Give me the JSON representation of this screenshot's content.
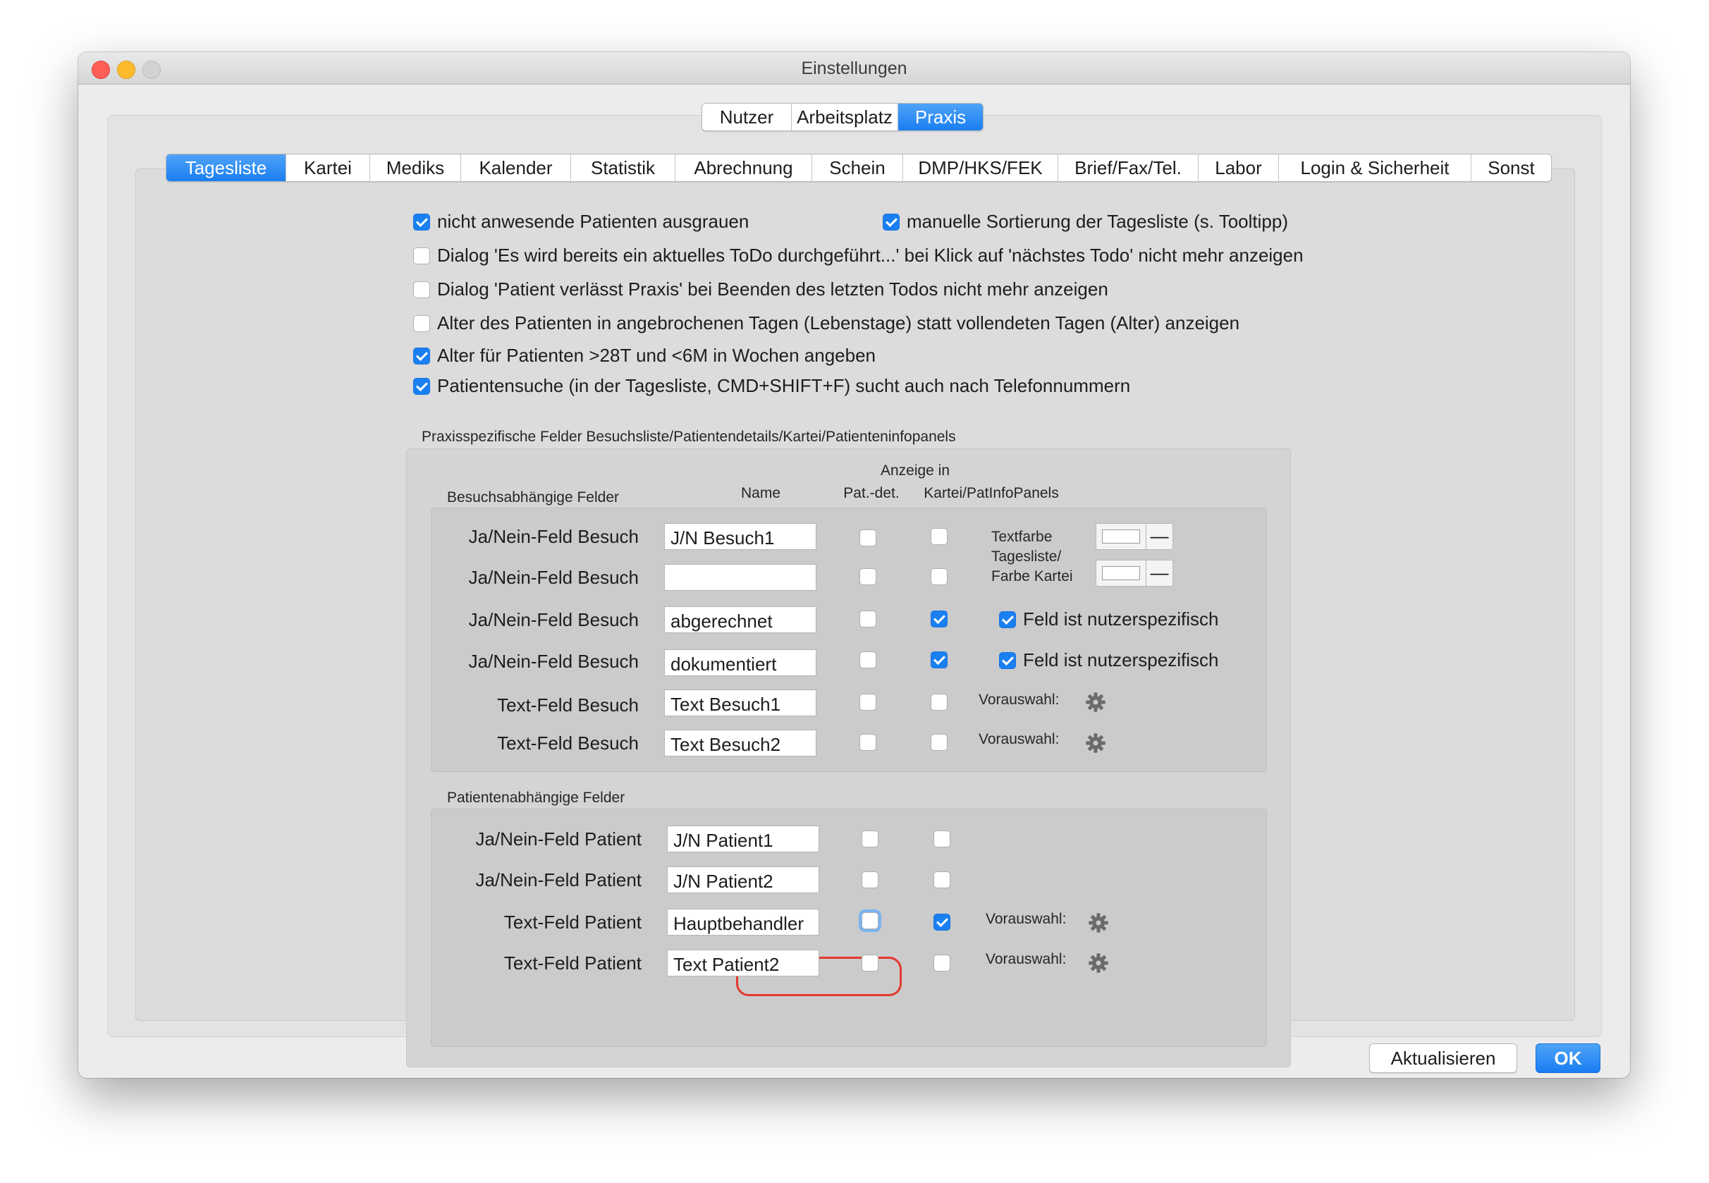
{
  "window": {
    "title": "Einstellungen"
  },
  "top_tabs": [
    {
      "label": "Nutzer",
      "active": false
    },
    {
      "label": "Arbeitsplatz",
      "active": false
    },
    {
      "label": "Praxis",
      "active": true
    }
  ],
  "sub_tabs": [
    {
      "label": "Tagesliste",
      "active": true
    },
    {
      "label": "Kartei",
      "active": false
    },
    {
      "label": "Mediks",
      "active": false
    },
    {
      "label": "Kalender",
      "active": false
    },
    {
      "label": "Statistik",
      "active": false
    },
    {
      "label": "Abrechnung",
      "active": false
    },
    {
      "label": "Schein",
      "active": false
    },
    {
      "label": "DMP/HKS/FEK",
      "active": false
    },
    {
      "label": "Brief/Fax/Tel.",
      "active": false
    },
    {
      "label": "Labor",
      "active": false
    },
    {
      "label": "Login & Sicherheit",
      "active": false
    },
    {
      "label": "Sonst",
      "active": false
    }
  ],
  "options": [
    {
      "label": "nicht anwesende Patienten ausgrauen",
      "checked": true
    },
    {
      "label": "manuelle Sortierung der Tagesliste (s. Tooltipp)",
      "checked": true
    },
    {
      "label": "Dialog 'Es wird bereits ein aktuelles ToDo durchgeführt...' bei Klick auf 'nächstes Todo' nicht mehr anzeigen",
      "checked": false
    },
    {
      "label": "Dialog 'Patient verlässt Praxis' bei Beenden des letzten Todos nicht mehr anzeigen",
      "checked": false
    },
    {
      "label": "Alter des Patienten in angebrochenen Tagen (Lebenstage) statt vollendeten Tagen (Alter) anzeigen",
      "checked": false
    },
    {
      "label": "Alter für Patienten >28T und <6M in Wochen angeben",
      "checked": true
    },
    {
      "label": "Patientensuche (in der Tagesliste, CMD+SHIFT+F) sucht auch nach Telefonnummern",
      "checked": true
    }
  ],
  "custom_fields": {
    "group_title": "Praxisspezifische Felder Besuchsliste/Patientendetails/Kartei/Patienteninfopanels",
    "visit_section_title": "Besuchsabhängige Felder",
    "col_name": "Name",
    "col_display_in": "Anzeige in",
    "col_patdet": "Pat.-det.",
    "col_kartei": "Kartei/PatInfoPanels",
    "text_color_label": "Textfarbe Tagesliste/ Farbe Kartei",
    "user_specific_label": "Feld ist nutzerspezifisch",
    "preselect_label": "Vorauswahl:",
    "minus": "—",
    "visit_rows": [
      {
        "label": "Ja/Nein-Feld Besuch",
        "name": "J/N Besuch1",
        "patdet": false,
        "kartei": false,
        "user_specific": null
      },
      {
        "label": "Ja/Nein-Feld Besuch",
        "name": "",
        "patdet": false,
        "kartei": false,
        "user_specific": null
      },
      {
        "label": "Ja/Nein-Feld Besuch",
        "name": "abgerechnet",
        "patdet": false,
        "kartei": true,
        "user_specific": true
      },
      {
        "label": "Ja/Nein-Feld Besuch",
        "name": "dokumentiert",
        "patdet": false,
        "kartei": true,
        "user_specific": true
      },
      {
        "label": "Text-Feld Besuch",
        "name": "Text Besuch1",
        "patdet": false,
        "kartei": false
      },
      {
        "label": "Text-Feld Besuch",
        "name": "Text Besuch2",
        "patdet": false,
        "kartei": false
      }
    ],
    "patient_section_title": "Patientenabhängige Felder",
    "patient_rows": [
      {
        "label": "Ja/Nein-Feld Patient",
        "name": "J/N Patient1",
        "patdet": false,
        "kartei": false
      },
      {
        "label": "Ja/Nein-Feld Patient",
        "name": "J/N Patient2",
        "patdet": false,
        "kartei": false
      },
      {
        "label": "Text-Feld Patient",
        "name": "Hauptbehandler",
        "patdet": false,
        "kartei": true
      },
      {
        "label": "Text-Feld Patient",
        "name": "Text Patient2",
        "patdet": false,
        "kartei": false
      }
    ]
  },
  "buttons": {
    "refresh": "Aktualisieren",
    "ok": "OK"
  },
  "colors": {
    "accent": "#1a80f2",
    "highlight_ring": "#e33a2e"
  }
}
